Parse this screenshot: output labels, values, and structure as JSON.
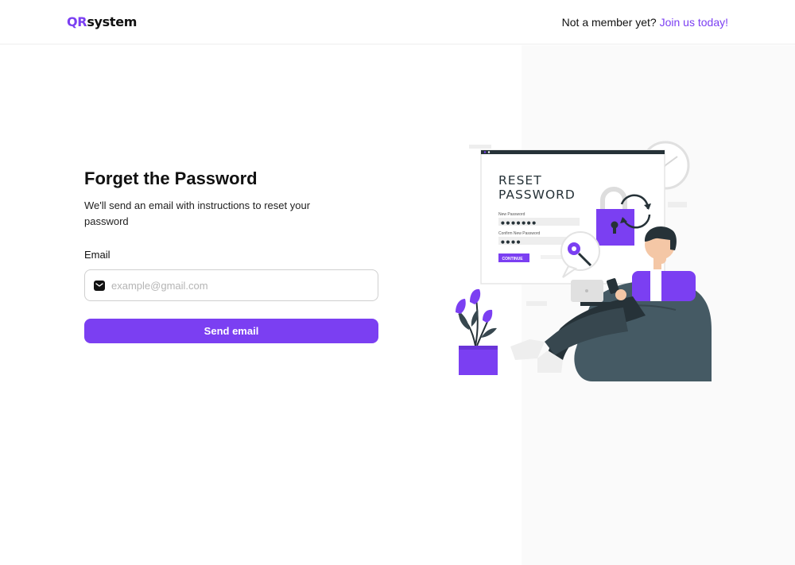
{
  "header": {
    "logo_accent": "QR",
    "logo_rest": "system",
    "member_prompt": "Not a member yet?",
    "join_link": "Join us today!"
  },
  "form": {
    "title": "Forget the Password",
    "subtitle": "We'll send an email with instructions to reset your password",
    "email_label": "Email",
    "email_placeholder": "example@gmail.com",
    "email_value": "",
    "submit_label": "Send email"
  },
  "illustration": {
    "heading_line1": "RESET",
    "heading_line2": "PASSWORD",
    "new_password_label": "New Password",
    "confirm_password_label": "Confirm New Password",
    "new_password_mask": "● ● ● ● ● ● ●",
    "confirm_password_mask": "● ● ● ●",
    "continue_label": "CONTINUE"
  },
  "theme": {
    "accent": "#7b3ff2",
    "text": "#111111",
    "muted": "#b4b4b4"
  }
}
